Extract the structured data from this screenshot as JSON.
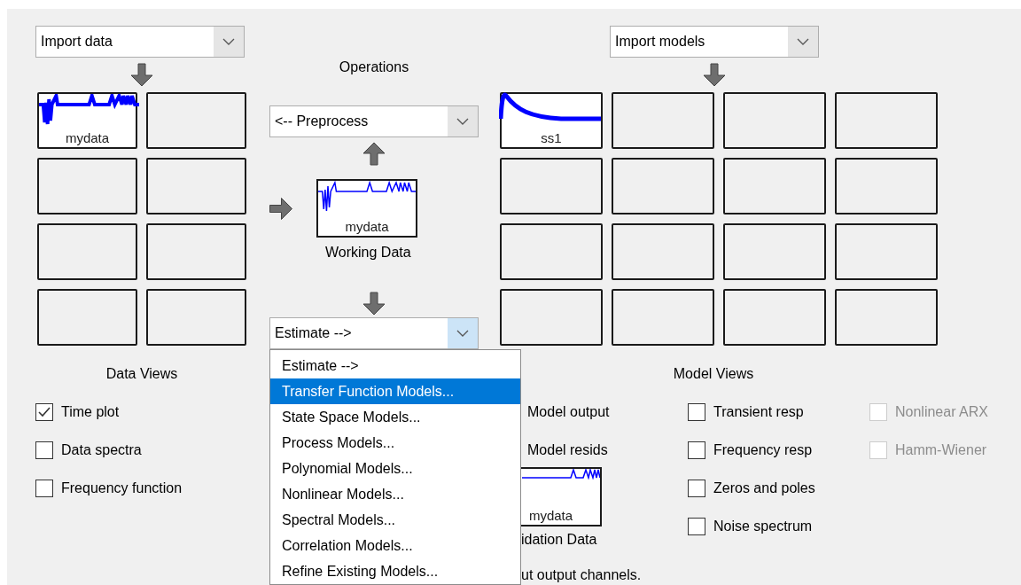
{
  "data_import": {
    "value": "Import data"
  },
  "data_slots": [
    {
      "kind": "data",
      "label": "mydata"
    },
    {
      "kind": "empty"
    },
    {
      "kind": "empty"
    },
    {
      "kind": "empty"
    },
    {
      "kind": "empty"
    },
    {
      "kind": "empty"
    },
    {
      "kind": "empty"
    },
    {
      "kind": "empty"
    }
  ],
  "operations": {
    "title": "Operations",
    "preprocess": "<-- Preprocess",
    "working_data": {
      "label": "mydata",
      "caption": "Working Data"
    },
    "estimate": {
      "value": "Estimate -->",
      "expanded": true
    }
  },
  "estimate_menu": [
    {
      "label": "Estimate -->",
      "selected": false
    },
    {
      "label": "Transfer Function Models...",
      "selected": true
    },
    {
      "label": "State Space Models...",
      "selected": false
    },
    {
      "label": "Process Models...",
      "selected": false
    },
    {
      "label": "Polynomial Models...",
      "selected": false
    },
    {
      "label": "Nonlinear Models...",
      "selected": false
    },
    {
      "label": "Spectral Models...",
      "selected": false
    },
    {
      "label": "Correlation Models...",
      "selected": false
    },
    {
      "label": "Refine Existing Models...",
      "selected": false
    }
  ],
  "model_import": {
    "value": "Import models"
  },
  "model_slots": [
    {
      "kind": "model",
      "label": "ss1"
    },
    {
      "kind": "empty"
    },
    {
      "kind": "empty"
    },
    {
      "kind": "empty"
    },
    {
      "kind": "empty"
    },
    {
      "kind": "empty"
    },
    {
      "kind": "empty"
    },
    {
      "kind": "empty"
    },
    {
      "kind": "empty"
    },
    {
      "kind": "empty"
    },
    {
      "kind": "empty"
    },
    {
      "kind": "empty"
    },
    {
      "kind": "empty"
    },
    {
      "kind": "empty"
    },
    {
      "kind": "empty"
    },
    {
      "kind": "empty"
    }
  ],
  "data_views": {
    "title": "Data Views",
    "options": [
      {
        "label": "Time plot",
        "checked": true
      },
      {
        "label": "Data spectra",
        "checked": false
      },
      {
        "label": "Frequency function",
        "checked": false
      }
    ]
  },
  "model_views": {
    "title": "Model Views",
    "column_1": [
      {
        "label": "Model output"
      },
      {
        "label": "Model resids"
      }
    ],
    "validation_data": {
      "label": "mydata",
      "caption": "idation Data"
    },
    "hint": "ut output channels.",
    "column_2": [
      {
        "label": "Transient resp",
        "checked": false
      },
      {
        "label": "Frequency resp",
        "checked": false
      },
      {
        "label": "Zeros and poles",
        "checked": false
      },
      {
        "label": "Noise spectrum",
        "checked": false
      }
    ],
    "column_3": [
      {
        "label": "Nonlinear ARX",
        "checked": false,
        "disabled": true
      },
      {
        "label": "Hamm-Wiener",
        "checked": false,
        "disabled": true
      }
    ]
  }
}
